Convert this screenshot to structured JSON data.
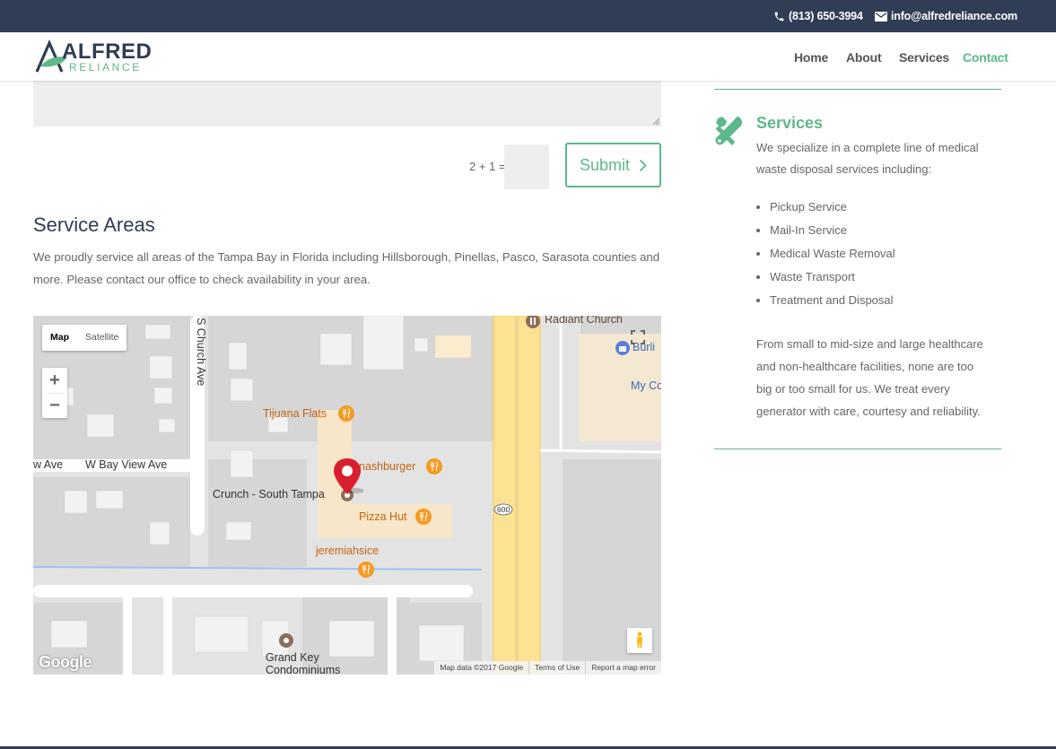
{
  "topbar": {
    "phone": "(813) 650-3994",
    "email": "info@alfredreliance.com"
  },
  "logo": {
    "line1": "ALFRED",
    "line2": "RELIANCE"
  },
  "nav": [
    {
      "label": "Home"
    },
    {
      "label": "About"
    },
    {
      "label": "Services"
    },
    {
      "label": "Contact"
    }
  ],
  "form": {
    "captcha_label": "2 + 1 =",
    "captcha_value": "",
    "submit_label": "Submit"
  },
  "service_areas": {
    "title": "Service Areas",
    "text": "We proudly service all areas of the Tampa Bay in Florida including Hillsborough, Pinellas, Pasco, Sarasota counties and more. Please contact our office to check availability in your area."
  },
  "map": {
    "type_map": "Map",
    "type_satellite": "Satellite",
    "zoom_in": "+",
    "zoom_out": "−",
    "google_logo": "Google",
    "attribution": {
      "data": "Map data ©2017 Google",
      "terms": "Terms of Use",
      "report": "Report a map error"
    },
    "labels": {
      "s_church_ave": "S Church Ave",
      "w_bay_view_ave": "W Bay View Ave",
      "w_ave": "w Ave",
      "tijuana_flats": "Tijuana Flats",
      "smashburger": "nashburger",
      "crunch": "Crunch - South Tampa",
      "pizza_hut": "Pizza Hut",
      "jeremiahsice": "jeremiahsice",
      "radiant_church": "Radiant Church",
      "burlington": "Burli",
      "my_co": "My Co",
      "grand_key_1": "Grand Key",
      "grand_key_2": "Condominiums",
      "route": "600"
    }
  },
  "sidebar": {
    "title": "Services",
    "intro": "We specialize in a complete line of medical waste disposal services including:",
    "items": [
      "Pickup Service",
      "Mail-In Service",
      "Medical Waste Removal",
      "Waste Transport",
      "Treatment and Disposal"
    ],
    "paragraph": "From small to mid-size and large healthcare and non-healthcare facilities, none are too big or too small for us. We treat every generator with care, courtesy and reliability."
  },
  "colors": {
    "navy": "#2f3d55",
    "green": "#5db88a",
    "text": "#666666"
  }
}
